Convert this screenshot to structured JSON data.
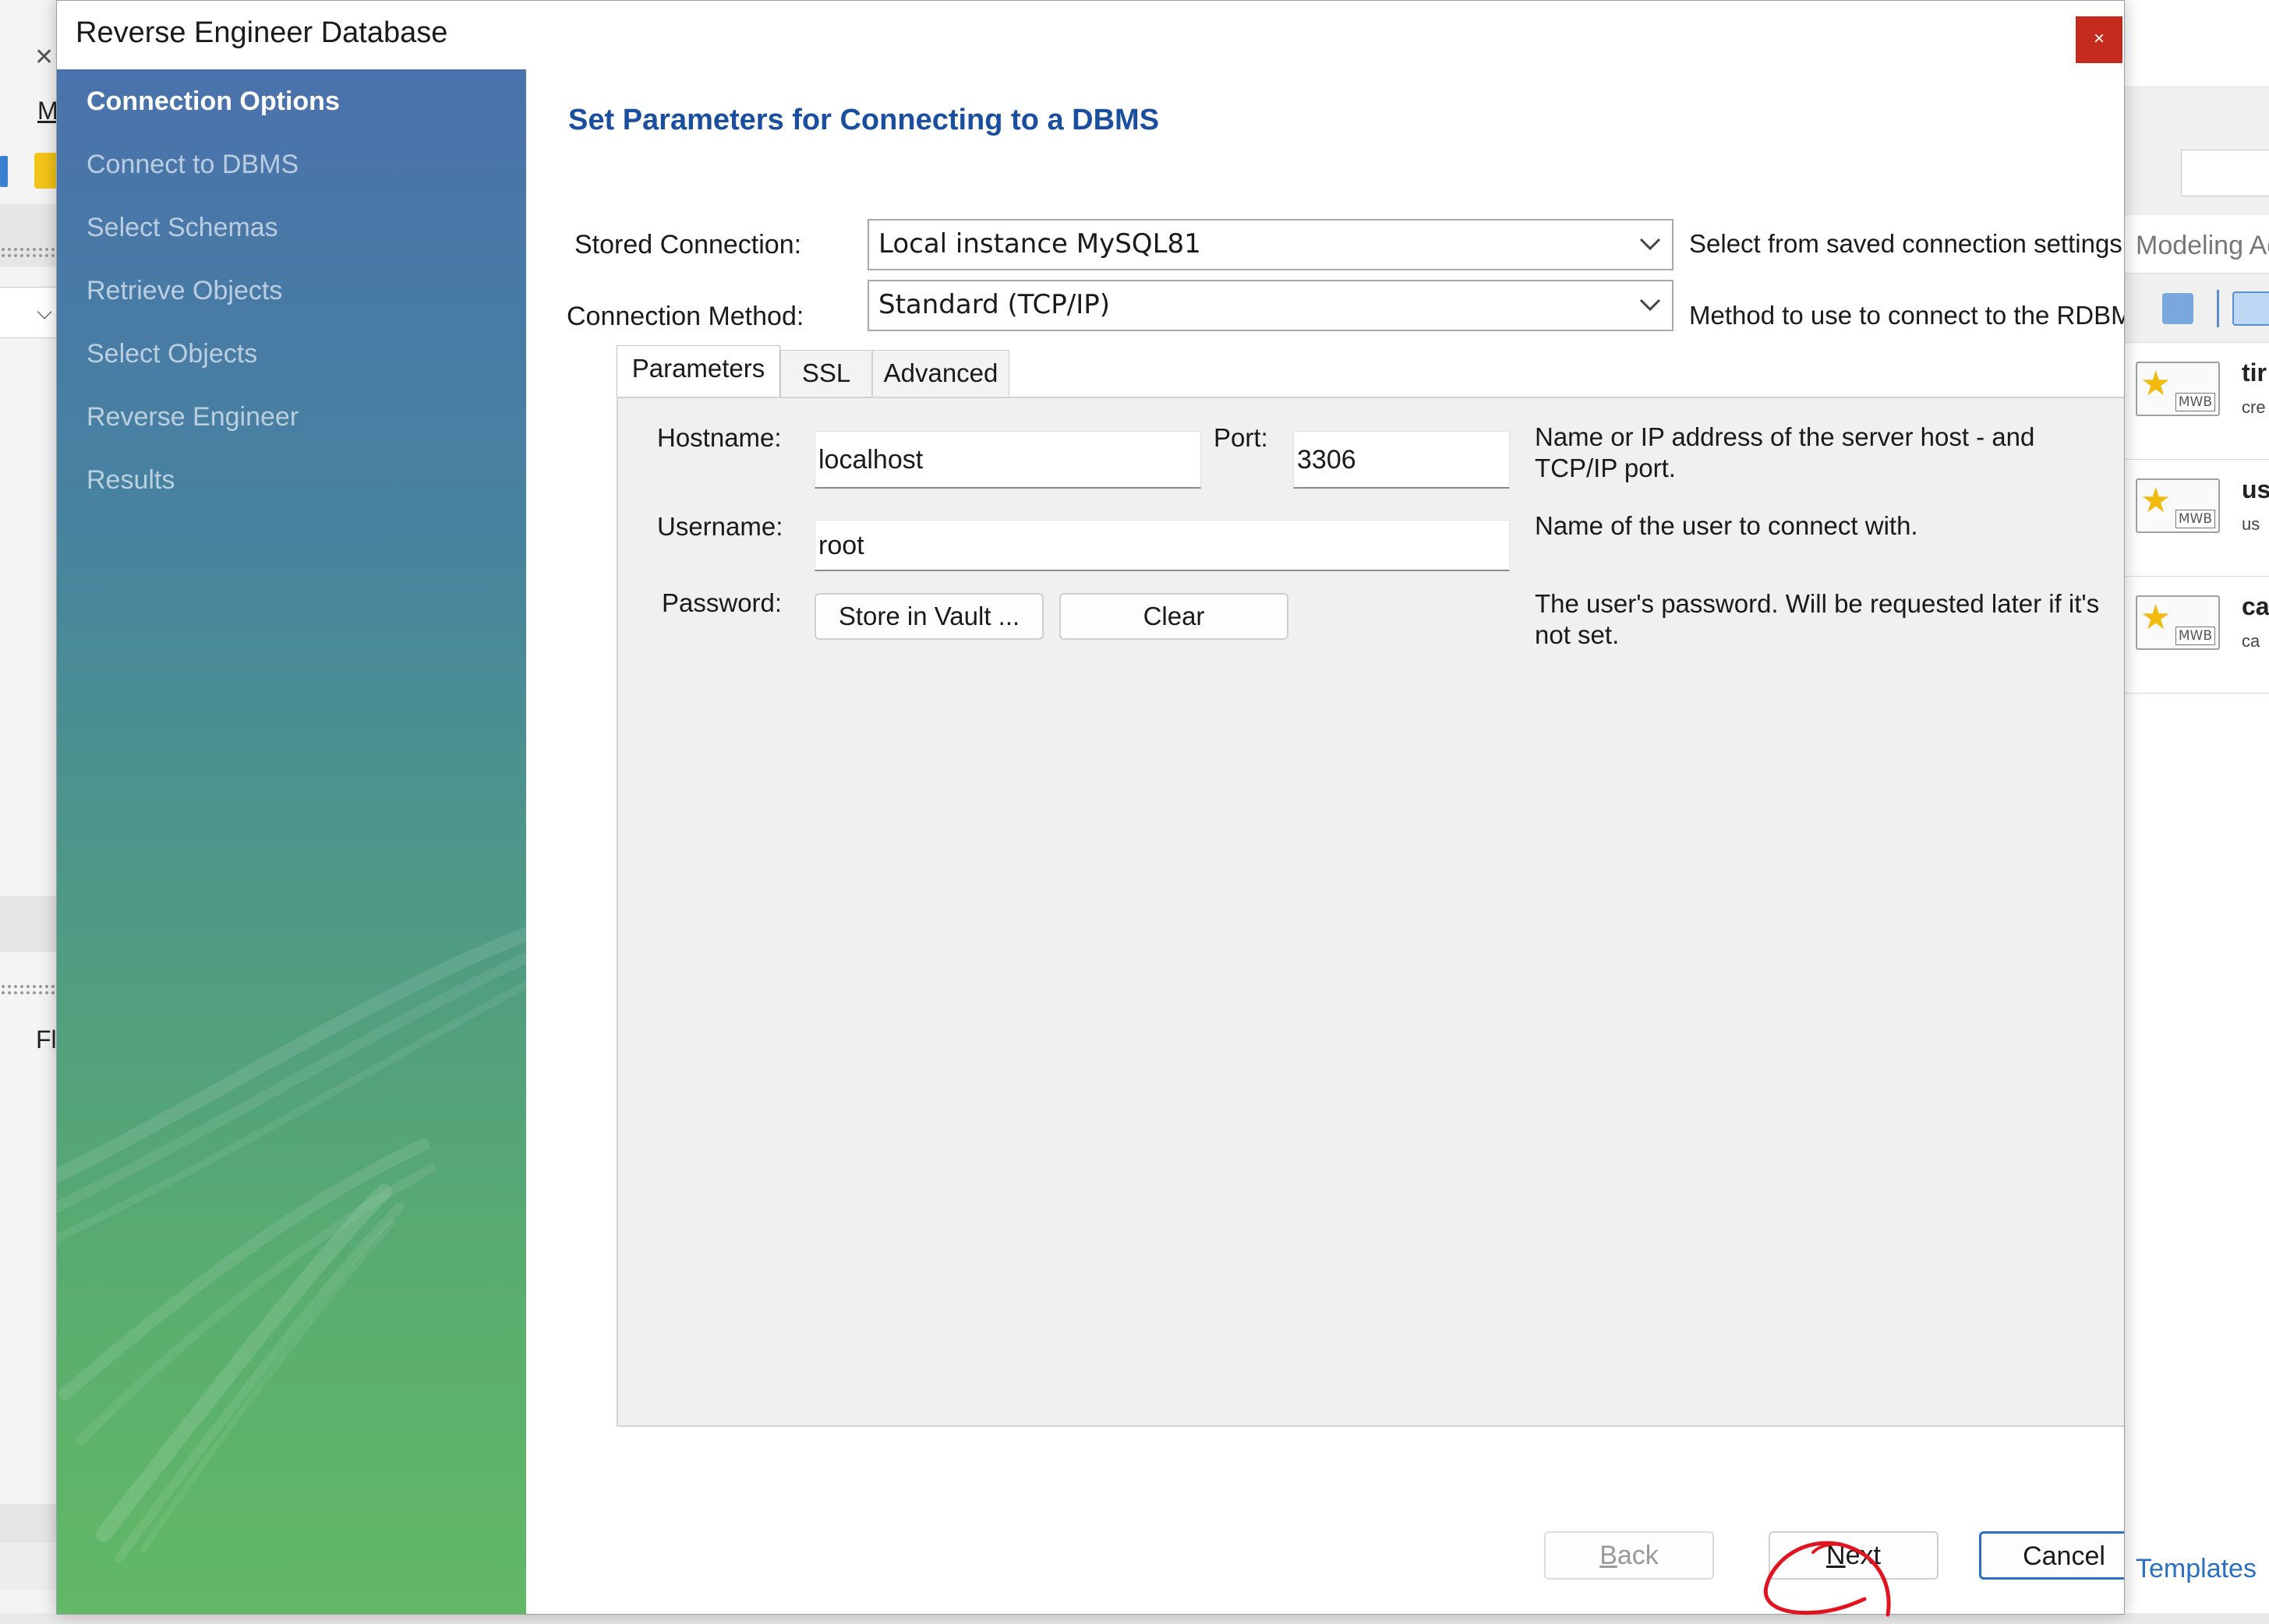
{
  "background": {
    "left_menu_letter": "M",
    "left_tree_text": "Fl",
    "right_panel_title": "Modeling Ac",
    "templates": [
      {
        "title": "tir",
        "sub": "cre",
        "badge": "MWB"
      },
      {
        "title": "us",
        "sub": "us",
        "badge": "MWB"
      },
      {
        "title": "ca",
        "sub": "ca",
        "badge": "MWB"
      }
    ],
    "templates_link": "Templates"
  },
  "dialog": {
    "title": "Reverse Engineer Database",
    "close_glyph": "×",
    "steps": [
      {
        "label": "Connection Options",
        "active": true
      },
      {
        "label": "Connect to DBMS",
        "active": false
      },
      {
        "label": "Select Schemas",
        "active": false
      },
      {
        "label": "Retrieve Objects",
        "active": false
      },
      {
        "label": "Select Objects",
        "active": false
      },
      {
        "label": "Reverse Engineer",
        "active": false
      },
      {
        "label": "Results",
        "active": false
      }
    ],
    "heading": "Set Parameters for Connecting to a DBMS",
    "stored_connection": {
      "label": "Stored Connection:",
      "value": "Local instance MySQL81",
      "hint": "Select from saved connection settings"
    },
    "connection_method": {
      "label": "Connection Method:",
      "value": "Standard (TCP/IP)",
      "hint": "Method to use to connect to the RDBMS"
    },
    "tabs": [
      {
        "label": "Parameters",
        "active": true
      },
      {
        "label": "SSL",
        "active": false
      },
      {
        "label": "Advanced",
        "active": false
      }
    ],
    "parameters": {
      "hostname_label": "Hostname:",
      "hostname_value": "localhost",
      "port_label": "Port:",
      "port_value": "3306",
      "host_hint_line1": "Name or IP address of the server host - and",
      "host_hint_line2": "TCP/IP port.",
      "username_label": "Username:",
      "username_value": "root",
      "username_hint": "Name of the user to connect with.",
      "password_label": "Password:",
      "store_vault_label": "Store in Vault ...",
      "clear_label": "Clear",
      "password_hint_line1": "The user's password. Will be requested later if it's",
      "password_hint_line2": "not set."
    },
    "buttons": {
      "back_mnemonic": "B",
      "back_rest": "ack",
      "next_mnemonic": "N",
      "next_rest": "ext",
      "cancel": "Cancel"
    }
  },
  "colors": {
    "heading_blue": "#1a4fa0",
    "sidebar_top": "#4a72ac",
    "sidebar_bottom": "#62b866",
    "close_red": "#c42b1c",
    "default_button_border": "#2a6fc0",
    "annotation_red": "#e0141e"
  }
}
